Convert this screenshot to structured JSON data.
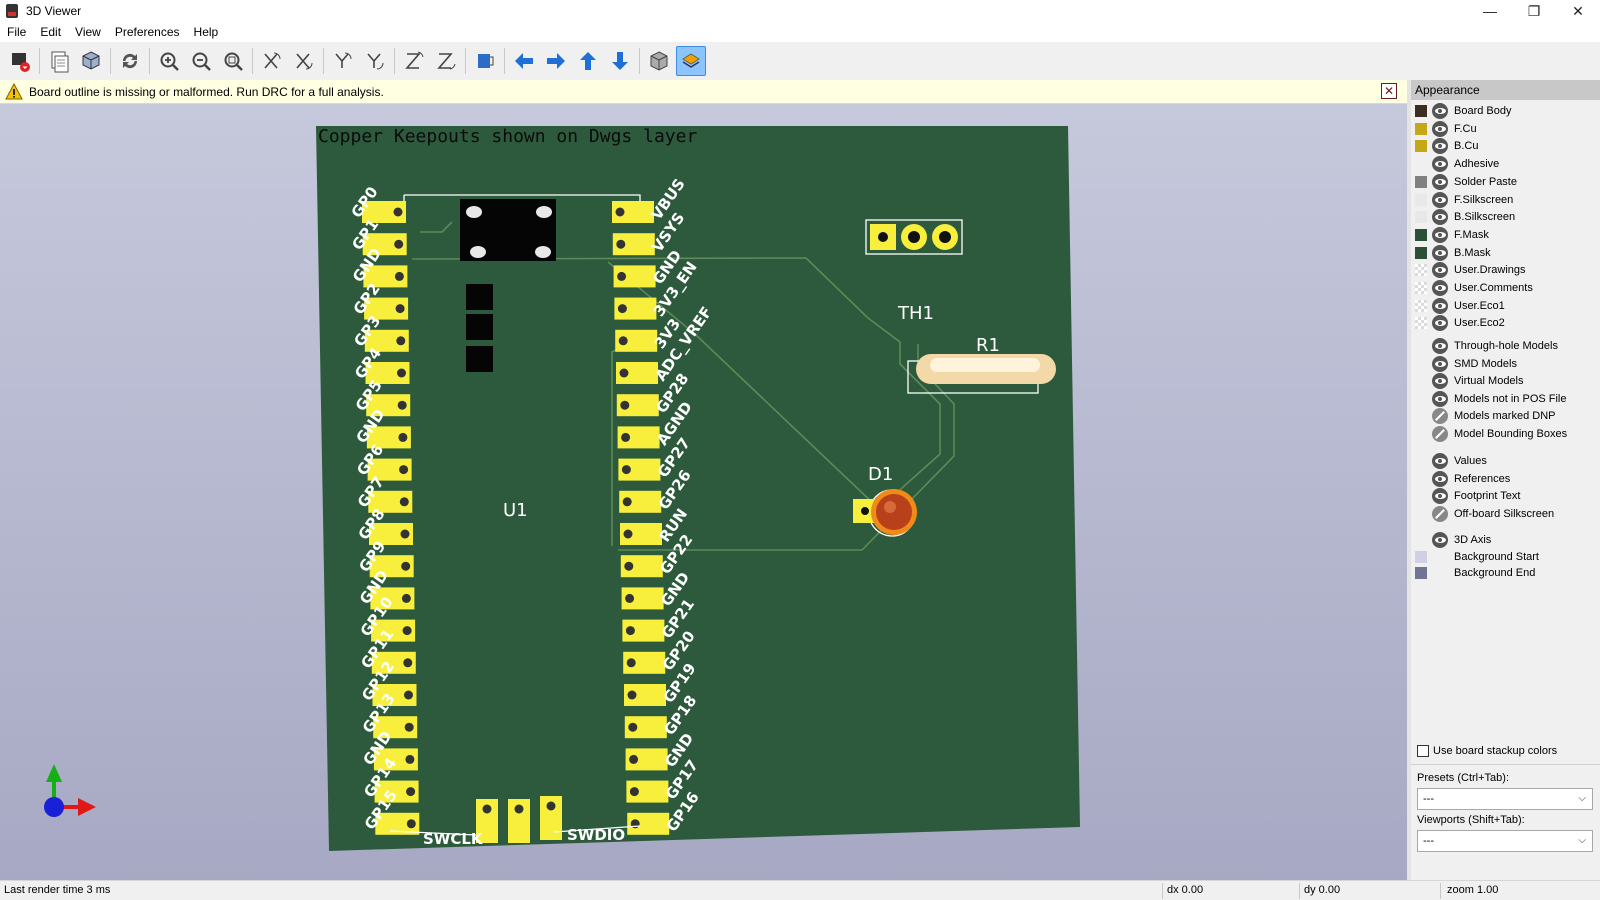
{
  "window": {
    "title": "3D Viewer",
    "minimize_glyph": "—",
    "maximize_glyph": "❐",
    "close_glyph": "✕"
  },
  "menu": [
    "File",
    "Edit",
    "View",
    "Preferences",
    "Help"
  ],
  "toolbar": {
    "buttons": [
      {
        "icon": "render-export-icon"
      },
      {
        "icon": "copy-image-icon"
      },
      {
        "icon": "raytrace-cube-icon"
      },
      {
        "icon": "reload-icon"
      },
      {
        "icon": "zoom-in-icon"
      },
      {
        "icon": "zoom-out-icon"
      },
      {
        "icon": "zoom-fit-icon"
      },
      {
        "icon": "rotate-x-cw-icon"
      },
      {
        "icon": "rotate-x-ccw-icon"
      },
      {
        "icon": "rotate-y-cw-icon"
      },
      {
        "icon": "rotate-y-ccw-icon"
      },
      {
        "icon": "rotate-z-cw-icon"
      },
      {
        "icon": "rotate-z-ccw-icon"
      },
      {
        "icon": "flip-board-icon"
      },
      {
        "icon": "pan-left-icon"
      },
      {
        "icon": "pan-right-icon"
      },
      {
        "icon": "pan-up-icon"
      },
      {
        "icon": "pan-down-icon"
      },
      {
        "icon": "orthographic-icon"
      },
      {
        "icon": "layers-manager-icon",
        "active": true
      }
    ]
  },
  "infobar": {
    "message": "Board outline is missing or malformed. Run DRC for a full analysis.",
    "close_glyph": "✕"
  },
  "board": {
    "colors": {
      "board": "#2d5a3c",
      "pad": "#f7ef3c",
      "trace": "#5d8a58",
      "silk": "#ffffff"
    },
    "keepout_note": "Copper Keepouts shown on Dwgs layer",
    "left_pins": [
      "GP0",
      "GP1",
      "GND",
      "GP2",
      "GP3",
      "GP4",
      "GP5",
      "GND",
      "GP6",
      "GP7",
      "GP8",
      "GP9",
      "GND",
      "GP10",
      "GP11",
      "GP12",
      "GP13",
      "GND",
      "GP14",
      "GP15"
    ],
    "right_pins": [
      "VBUS",
      "VSYS",
      "GND",
      "3V3_EN",
      "3V3",
      "ADC_VREF",
      "GP28",
      "AGND",
      "GP27",
      "GP26",
      "RUN",
      "GP22",
      "GND",
      "GP21",
      "GP20",
      "GP19",
      "GP18",
      "GND",
      "GP17",
      "GP16"
    ],
    "bottom_labels": {
      "left": "SWCLK",
      "right": "SWDIO"
    },
    "refs": {
      "u1": "U1",
      "th1": "TH1",
      "r1": "R1",
      "d1": "D1"
    }
  },
  "axis_gizmo": {
    "x_color": "#e01818",
    "y_color": "#16b016",
    "z_color": "#1820d8"
  },
  "panel": {
    "title": "Appearance",
    "layers": [
      {
        "name": "Board Body",
        "color": "#3b2e20",
        "eye": "on"
      },
      {
        "name": "F.Cu",
        "color": "#c4a818",
        "eye": "on"
      },
      {
        "name": "B.Cu",
        "color": "#c4a818",
        "eye": "on"
      },
      {
        "name": "Adhesive",
        "color": "",
        "eye": "on"
      },
      {
        "name": "Solder Paste",
        "color": "#808080",
        "eye": "on"
      },
      {
        "name": "F.Silkscreen",
        "color": "#e8e8e8",
        "eye": "on"
      },
      {
        "name": "B.Silkscreen",
        "color": "#e8e8e8",
        "eye": "on"
      },
      {
        "name": "F.Mask",
        "color": "#2a5038",
        "eye": "on"
      },
      {
        "name": "B.Mask",
        "color": "#2a5038",
        "eye": "on"
      },
      {
        "name": "User.Drawings",
        "color": "checker",
        "eye": "on"
      },
      {
        "name": "User.Comments",
        "color": "checker",
        "eye": "on"
      },
      {
        "name": "User.Eco1",
        "color": "checker",
        "eye": "on"
      },
      {
        "name": "User.Eco2",
        "color": "checker",
        "eye": "on"
      }
    ],
    "model_items": [
      {
        "name": "Through-hole Models",
        "eye": "on"
      },
      {
        "name": "SMD Models",
        "eye": "on"
      },
      {
        "name": "Virtual Models",
        "eye": "on"
      },
      {
        "name": "Models not in POS File",
        "eye": "on"
      },
      {
        "name": "Models marked DNP",
        "eye": "off"
      },
      {
        "name": "Model Bounding Boxes",
        "eye": "off"
      }
    ],
    "text_items": [
      {
        "name": "Values",
        "eye": "on"
      },
      {
        "name": "References",
        "eye": "on"
      },
      {
        "name": "Footprint Text",
        "eye": "on"
      },
      {
        "name": "Off-board Silkscreen",
        "eye": "off"
      }
    ],
    "misc_items": [
      {
        "name": "3D Axis",
        "color": "",
        "eye": "on"
      },
      {
        "name": "Background Start",
        "color": "#cfd0e4",
        "eye": "none"
      },
      {
        "name": "Background End",
        "color": "#717495",
        "eye": "none"
      }
    ],
    "stackup_label": "Use board stackup colors",
    "presets_label": "Presets (Ctrl+Tab):",
    "presets_value": "---",
    "viewports_label": "Viewports (Shift+Tab):",
    "viewports_value": "---"
  },
  "status": {
    "render_time": "Last render time 3 ms",
    "dx": "dx 0.00",
    "dy": "dy 0.00",
    "zoom": "zoom 1.00"
  }
}
